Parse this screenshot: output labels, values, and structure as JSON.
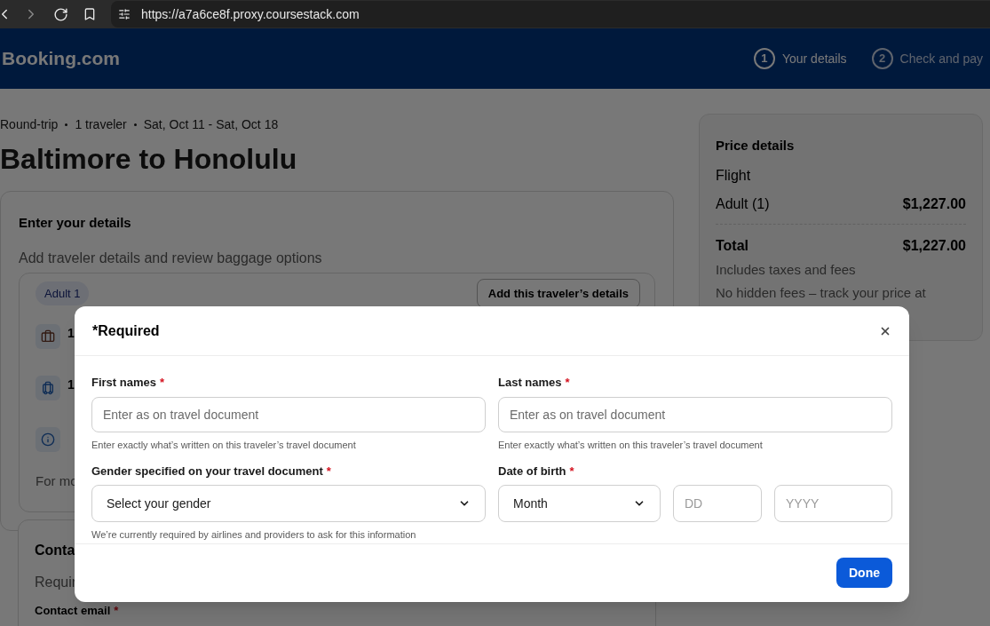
{
  "browser": {
    "url": "https://a7a6ce8f.proxy.coursestack.com"
  },
  "header": {
    "logo": "Booking.com",
    "steps": [
      {
        "number": "1",
        "label": "Your details",
        "selected": true
      },
      {
        "number": "2",
        "label": "Check and pay",
        "selected": false
      }
    ]
  },
  "trip": {
    "summary": [
      "Round-trip",
      "1 traveler",
      "Sat, Oct 11 - Sat, Oct 18"
    ],
    "title": "Baltimore to Honolulu"
  },
  "details_card": {
    "title": "Enter your details",
    "subtitle": "Add traveler details and review baggage options",
    "traveler": {
      "badge": "Adult 1",
      "button": "Add this traveler’s details",
      "items": [
        {
          "kind": "bag",
          "line1": "1"
        },
        {
          "kind": "suitcase",
          "line1": "1"
        },
        {
          "kind": "info"
        }
      ],
      "footer": "For mo"
    }
  },
  "contact_card": {
    "title": "Conta",
    "subtitle": "Requir",
    "email_label": "Contact email",
    "required_mark": "*"
  },
  "price": {
    "title": "Price details",
    "section": "Flight",
    "rows": [
      {
        "label": "Adult (1)",
        "amount": "$1,227.00"
      }
    ],
    "total_label": "Total",
    "total_amount": "$1,227.00",
    "notes": [
      "Includes taxes and fees",
      "No hidden fees – track your price at"
    ]
  },
  "modal": {
    "title": "*Required",
    "fields": [
      {
        "kind": "text",
        "label": "First names",
        "required": true,
        "placeholder": "Enter as on travel document",
        "hint": "Enter exactly what’s written on this traveler’s travel document"
      },
      {
        "kind": "text",
        "label": "Last names",
        "required": true,
        "placeholder": "Enter as on travel document",
        "hint": "Enter exactly what’s written on this traveler’s travel document"
      },
      {
        "kind": "select",
        "label": "Gender specified on your travel document",
        "required": true,
        "value": "Select your gender",
        "hint": "We’re currently required by airlines and providers to ask for this information"
      },
      {
        "kind": "date",
        "label": "Date of birth",
        "required": true,
        "month": "Month",
        "day_placeholder": "DD",
        "year_placeholder": "YYYY"
      }
    ],
    "required_mark": "*",
    "button": "Done"
  }
}
